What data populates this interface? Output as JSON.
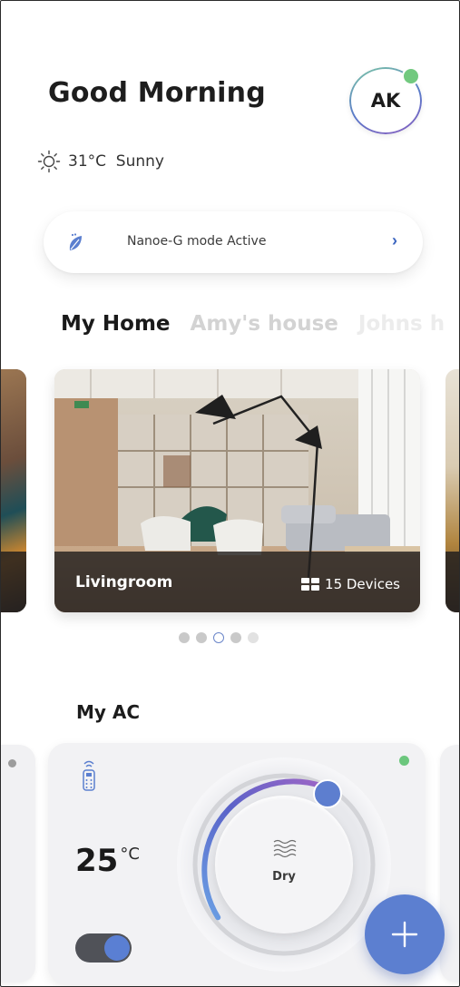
{
  "header": {
    "greeting": "Good Morning",
    "avatar_initials": "AK",
    "avatar_status_color": "#72c97f"
  },
  "weather": {
    "icon": "sun-icon",
    "text": "31°C  Sunny"
  },
  "banner": {
    "icon": "leaf-icon",
    "text": "Nanoe-G mode Active",
    "chevron": "›"
  },
  "homes": {
    "tabs": [
      {
        "label": "My Home",
        "active": true
      },
      {
        "label": "Amy's house",
        "active": false
      },
      {
        "label": "Johns h",
        "active": false
      }
    ]
  },
  "room_card": {
    "name": "Livingroom",
    "devices_icon": "grid-icon",
    "devices_text": "15 Devices"
  },
  "carousel": {
    "count": 5,
    "active_index": 2
  },
  "ac_section": {
    "title": "My AC",
    "card": {
      "temperature": "25",
      "unit": "°C",
      "mode": "Dry",
      "mode_icon": "dry-waves-icon",
      "power_on": true,
      "status_color": "#6cc77d",
      "remote_icon": "remote-icon"
    }
  },
  "fab": {
    "icon": "plus-icon"
  },
  "colors": {
    "accent": "#5c7fd0",
    "dial_gradient_start": "#5a86d6",
    "dial_gradient_end": "#9a63c2",
    "online": "#72c97f"
  }
}
